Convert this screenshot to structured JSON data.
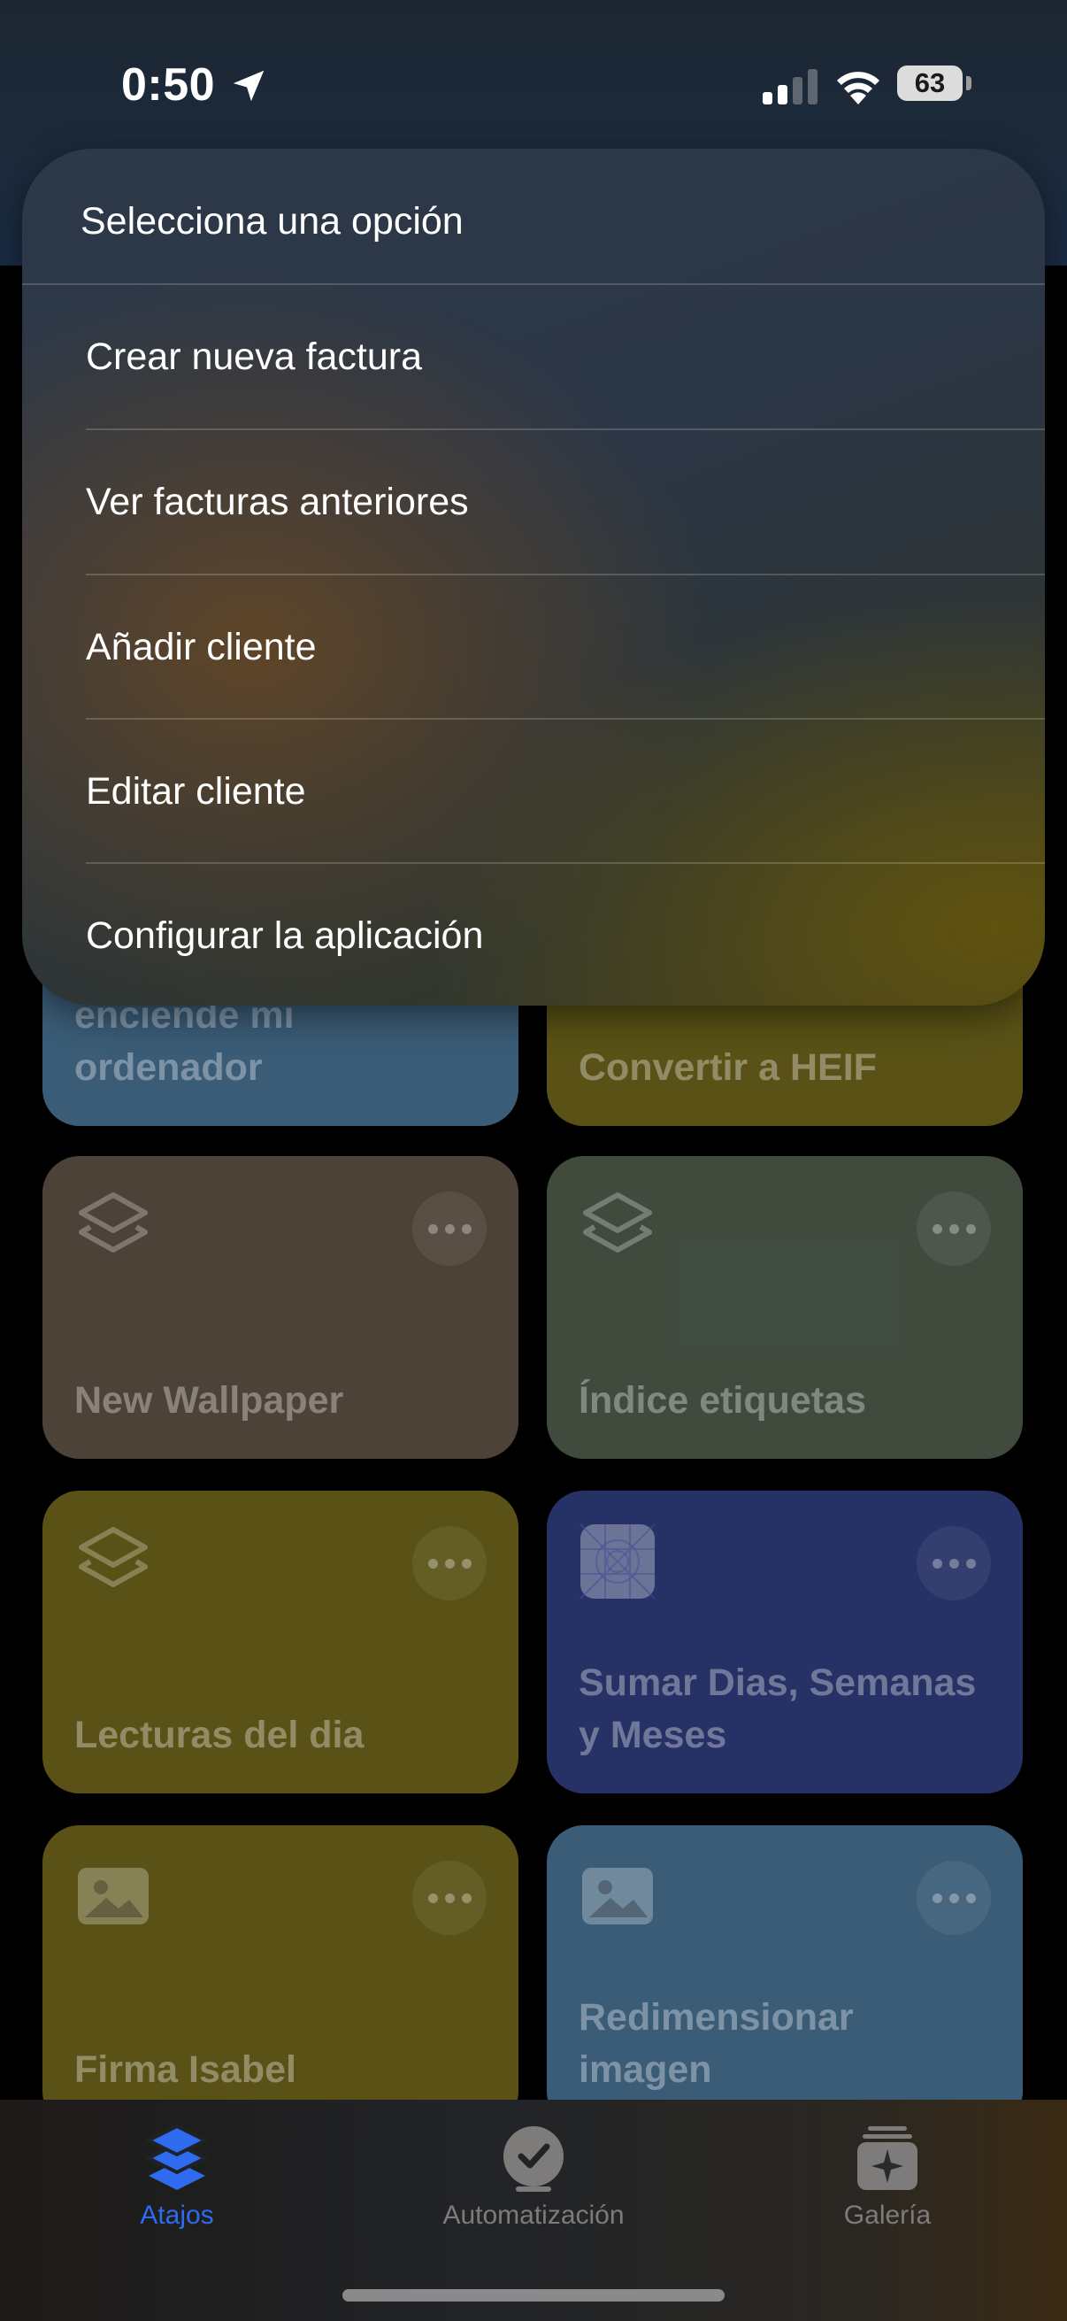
{
  "status_bar": {
    "time": "0:50",
    "battery": "63",
    "location_icon": "location-arrow-icon",
    "signal_icon": "cellular-signal-icon",
    "wifi_icon": "wifi-icon"
  },
  "menu": {
    "header": "Selecciona una opción",
    "items": [
      {
        "label": "Crear nueva factura"
      },
      {
        "label": "Ver facturas anteriores"
      },
      {
        "label": "Añadir cliente"
      },
      {
        "label": "Editar cliente"
      },
      {
        "label": "Configurar la aplicación"
      }
    ]
  },
  "shortcuts": [
    {
      "title": "enciende mi ordenador",
      "color": "#5e95c0",
      "icon": "none"
    },
    {
      "title": "Convertir a HEIF",
      "color": "#908324",
      "icon": "none"
    },
    {
      "title": "New Wallpaper",
      "color": "#7c6b59",
      "icon": "layers-icon"
    },
    {
      "title": "Índice etiquetas",
      "color": "#687a65",
      "icon": "layers-icon"
    },
    {
      "title": "Lecturas del dia",
      "color": "#908324",
      "icon": "layers-icon"
    },
    {
      "title": "Sumar Dias, Semanas y Meses",
      "color": "#3e4fa4",
      "icon": "app-grid-icon"
    },
    {
      "title": "Firma Isabel",
      "color": "#908324",
      "icon": "photo-icon"
    },
    {
      "title": "Redimensionar imagen",
      "color": "#5e95c0",
      "icon": "photo-icon"
    }
  ],
  "tab_bar": {
    "tabs": [
      {
        "label": "Atajos",
        "icon": "layers-icon",
        "active": true
      },
      {
        "label": "Automatización",
        "icon": "clock-check-icon",
        "active": false
      },
      {
        "label": "Galería",
        "icon": "gallery-sparkle-icon",
        "active": false
      }
    ],
    "active_color": "#2f6bf0",
    "inactive_color": "#7d7c7a"
  }
}
